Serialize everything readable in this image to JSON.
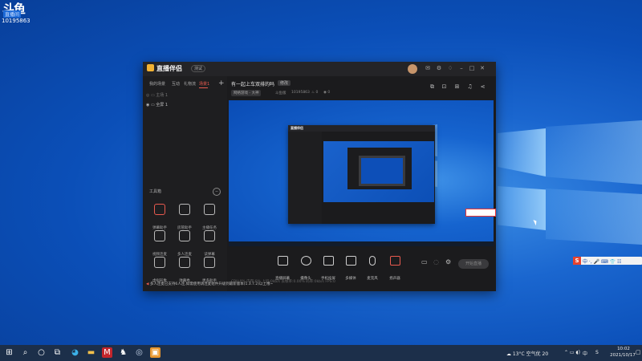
{
  "desktop_watermark": {
    "logo": "斗鱼",
    "sub": "直播间",
    "room_id": "10195863"
  },
  "app": {
    "brand": "直播伴侣",
    "brand_tag": "测试",
    "left_tabs": [
      "我的场景",
      "互动",
      "礼物流",
      "场景1"
    ],
    "plus_label": "+",
    "scene_rows": [
      "主场 1",
      "全屏 1"
    ],
    "tools_title": "工具箱",
    "tools": [
      {
        "label": "弹幕助手",
        "icon": "danmaku-icon",
        "active": true
      },
      {
        "label": "房管助手",
        "icon": "user-icon",
        "active": false
      },
      {
        "label": "主播任务",
        "icon": "shield-icon",
        "active": false
      },
      {
        "label": "视频连麦",
        "icon": "video-mic-icon",
        "active": false
      },
      {
        "label": "多人连麦",
        "icon": "multi-mic-icon",
        "active": false
      },
      {
        "label": "读弹幕",
        "icon": "read-danmaku-icon",
        "active": false
      },
      {
        "label": "虚拟形象",
        "icon": "avatar-icon",
        "active": false
      },
      {
        "label": "弹幕秀",
        "icon": "tv-icon",
        "active": false
      },
      {
        "label": "更多助手",
        "icon": "more-icon",
        "active": false
      }
    ],
    "notice": "多人连麦已支持6人连,如需使用请连麦组件升级到最新版本(1.3.7.2)以上哦~",
    "header": {
      "title": "有一起上车双排的吗",
      "badge": "修改",
      "category": "网络游戏 - 大神",
      "meta": [
        "斗鱼版",
        "10195863",
        "0",
        "0"
      ]
    },
    "bottom_tools": [
      "直播屏幕",
      "摄像头",
      "手机投屏",
      "多媒体",
      "麦克风",
      "扬声器"
    ],
    "go_live": "开始直播",
    "stats": "CPU:0% 内存:0% 上行:0kb/s 丢帧率:0.00% 码率:0kb/s FPS:0"
  },
  "desktop": {
    "ime_label": "中 ·, 🎤 ⌨ 👕 ☷",
    "weather": "13°C 空气优 20",
    "ime_tb": "中",
    "time": "10:02",
    "date": "2021/10/17"
  }
}
